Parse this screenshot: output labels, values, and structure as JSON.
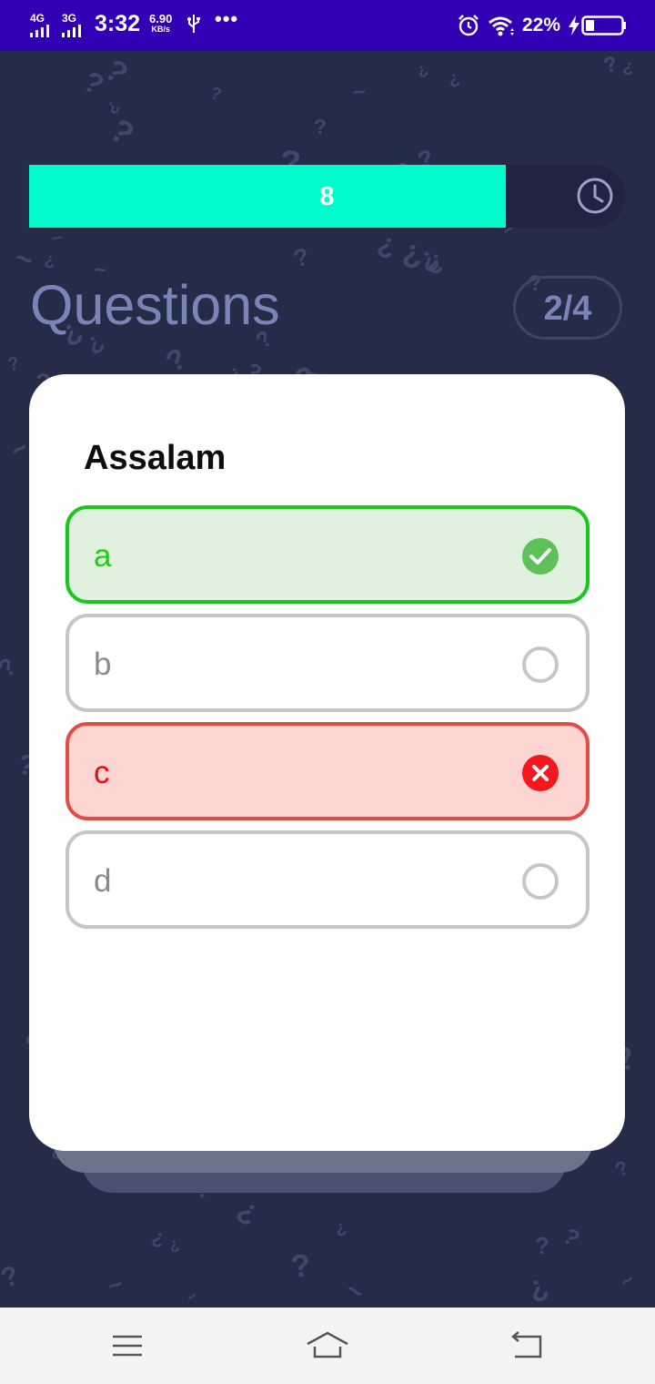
{
  "status_bar": {
    "network_1": "4G",
    "network_2": "3G",
    "time": "3:32",
    "speed_value": "6.90",
    "speed_unit": "KB/s",
    "more": "•••",
    "battery_percent": "22%",
    "icons": [
      "signal-icon",
      "usb-icon",
      "alarm-icon",
      "wifi-icon",
      "charging-icon",
      "battery-icon"
    ]
  },
  "timer": {
    "seconds_left": "8",
    "progress_fraction": 0.8,
    "fill_color": "#00fccc",
    "icon": "clock-icon"
  },
  "header": {
    "title": "Questions",
    "counter": "2/4"
  },
  "question": {
    "text": "Assalam",
    "options": [
      {
        "label": "a",
        "state": "correct",
        "icon": "check-circle-icon"
      },
      {
        "label": "b",
        "state": "unselected",
        "icon": "radio-empty-icon"
      },
      {
        "label": "c",
        "state": "wrong",
        "icon": "x-circle-icon"
      },
      {
        "label": "d",
        "state": "unselected",
        "icon": "radio-empty-icon"
      }
    ]
  },
  "colors": {
    "background": "#252c48",
    "status_bar": "#3200b4",
    "correct_border": "#18c71e",
    "correct_fill": "#e0f1df",
    "wrong_border": "#e44c43",
    "wrong_fill": "#fdd6d4"
  },
  "nav_bar": {
    "buttons": [
      "menu-icon",
      "home-icon",
      "back-icon"
    ]
  }
}
